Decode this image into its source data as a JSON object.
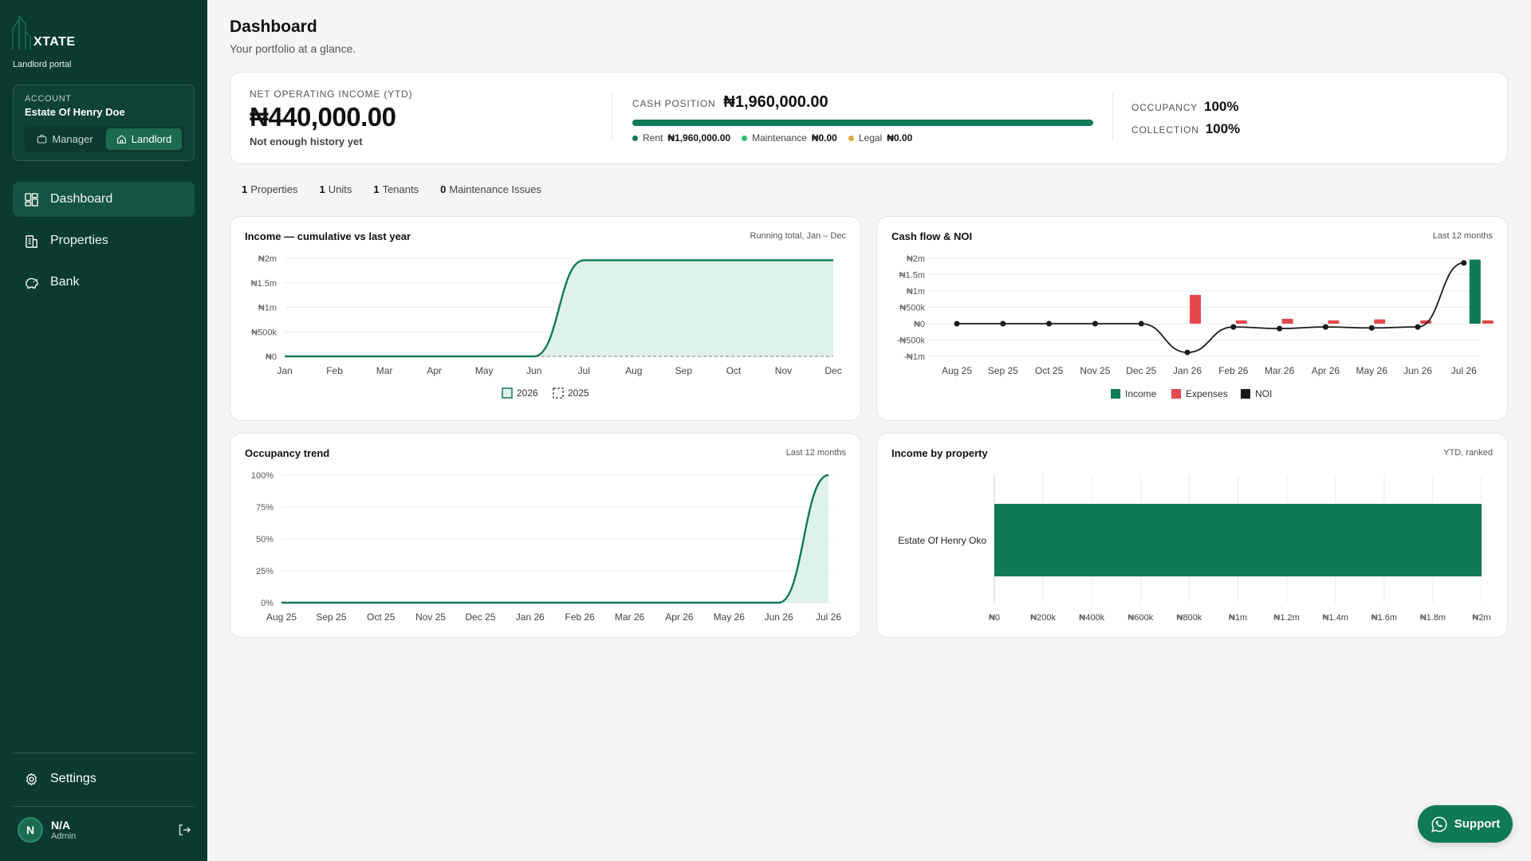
{
  "sidebar": {
    "logo_text": "XTATE",
    "portal_label": "Landlord portal",
    "account_label": "ACCOUNT",
    "account_name": "Estate Of Henry Doe",
    "roles": [
      "Manager",
      "Landlord"
    ],
    "active_role": "Landlord",
    "nav": [
      "Dashboard",
      "Properties",
      "Bank"
    ],
    "settings": "Settings",
    "user": {
      "initial": "N",
      "name": "N/A",
      "role": "Admin"
    }
  },
  "header": {
    "title": "Dashboard",
    "subtitle": "Your portfolio at a glance."
  },
  "kpis": {
    "noi_label": "NET OPERATING INCOME (YTD)",
    "noi_value": "₦440,000.00",
    "noi_note": "Not enough history yet",
    "cash_label": "CASH POSITION",
    "cash_value": "₦1,960,000.00",
    "cash_legend": [
      {
        "label": "Rent",
        "value": "₦1,960,000.00",
        "color": "#0f7a55"
      },
      {
        "label": "Maintenance",
        "value": "₦0.00",
        "color": "#2db872"
      },
      {
        "label": "Legal",
        "value": "₦0.00",
        "color": "#e8a33a"
      }
    ],
    "occupancy_label": "OCCUPANCY",
    "occupancy_value": "100%",
    "collection_label": "COLLECTION",
    "collection_value": "100%"
  },
  "stats": [
    {
      "count": "1",
      "label": "Properties"
    },
    {
      "count": "1",
      "label": "Units"
    },
    {
      "count": "1",
      "label": "Tenants"
    },
    {
      "count": "0",
      "label": "Maintenance Issues"
    }
  ],
  "support_label": "Support",
  "colors": {
    "primary": "#0f7a55",
    "sidebar": "#0a3a30",
    "expense": "#e5484d",
    "noi": "#1a1a1a"
  },
  "chart_data": [
    {
      "type": "area",
      "title": "Income — cumulative vs last year",
      "subtitle": "Running total, Jan – Dec",
      "categories": [
        "Jan",
        "Feb",
        "Mar",
        "Apr",
        "May",
        "Jun",
        "Jul",
        "Aug",
        "Sep",
        "Oct",
        "Nov",
        "Dec"
      ],
      "y_ticks": [
        "₦0",
        "₦500k",
        "₦1m",
        "₦1.5m",
        "₦2m"
      ],
      "ylim": [
        0,
        2000000
      ],
      "series": [
        {
          "name": "2026",
          "values": [
            0,
            0,
            0,
            0,
            0,
            0,
            1960000,
            1960000,
            1960000,
            1960000,
            1960000,
            1960000
          ]
        },
        {
          "name": "2025",
          "values": [
            0,
            0,
            0,
            0,
            0,
            0,
            0,
            0,
            0,
            0,
            0,
            0
          ]
        }
      ],
      "legend": "bottom"
    },
    {
      "type": "bar",
      "title": "Cash flow & NOI",
      "subtitle": "Last 12 months",
      "categories": [
        "Aug 25",
        "Sep 25",
        "Oct 25",
        "Nov 25",
        "Dec 25",
        "Jan 26",
        "Feb 26",
        "Mar 26",
        "Apr 26",
        "May 26",
        "Jun 26",
        "Jul 26"
      ],
      "y_ticks": [
        "-₦1m",
        "-₦500k",
        "₦0",
        "₦500k",
        "₦1m",
        "₦1.5m",
        "₦2m"
      ],
      "ylim": [
        -1000000,
        2000000
      ],
      "series": [
        {
          "name": "Income",
          "values": [
            0,
            0,
            0,
            0,
            0,
            0,
            0,
            0,
            0,
            0,
            0,
            1960000
          ]
        },
        {
          "name": "Expenses",
          "values": [
            0,
            0,
            0,
            0,
            0,
            880000,
            100000,
            150000,
            100000,
            130000,
            100000,
            100000
          ]
        },
        {
          "name": "NOI",
          "values": [
            0,
            0,
            0,
            0,
            0,
            -880000,
            -100000,
            -150000,
            -100000,
            -130000,
            -100000,
            1860000
          ]
        }
      ],
      "legend": "bottom"
    },
    {
      "type": "area",
      "title": "Occupancy trend",
      "subtitle": "Last 12 months",
      "categories": [
        "Aug 25",
        "Sep 25",
        "Oct 25",
        "Nov 25",
        "Dec 25",
        "Jan 26",
        "Feb 26",
        "Mar 26",
        "Apr 26",
        "May 26",
        "Jun 26",
        "Jul 26"
      ],
      "y_ticks": [
        "0%",
        "25%",
        "50%",
        "75%",
        "100%"
      ],
      "ylim": [
        0,
        100
      ],
      "series": [
        {
          "values": [
            0,
            0,
            0,
            0,
            0,
            0,
            0,
            0,
            0,
            0,
            0,
            100
          ]
        }
      ]
    },
    {
      "type": "bar",
      "orientation": "horizontal",
      "title": "Income by property",
      "subtitle": "YTD, ranked",
      "categories": [
        "Estate Of Henry Oko"
      ],
      "values": [
        2000000
      ],
      "x_ticks": [
        "₦0",
        "₦200k",
        "₦400k",
        "₦600k",
        "₦800k",
        "₦1m",
        "₦1.2m",
        "₦1.4m",
        "₦1.6m",
        "₦1.8m",
        "₦2m"
      ],
      "xlim": [
        0,
        2000000
      ]
    }
  ]
}
